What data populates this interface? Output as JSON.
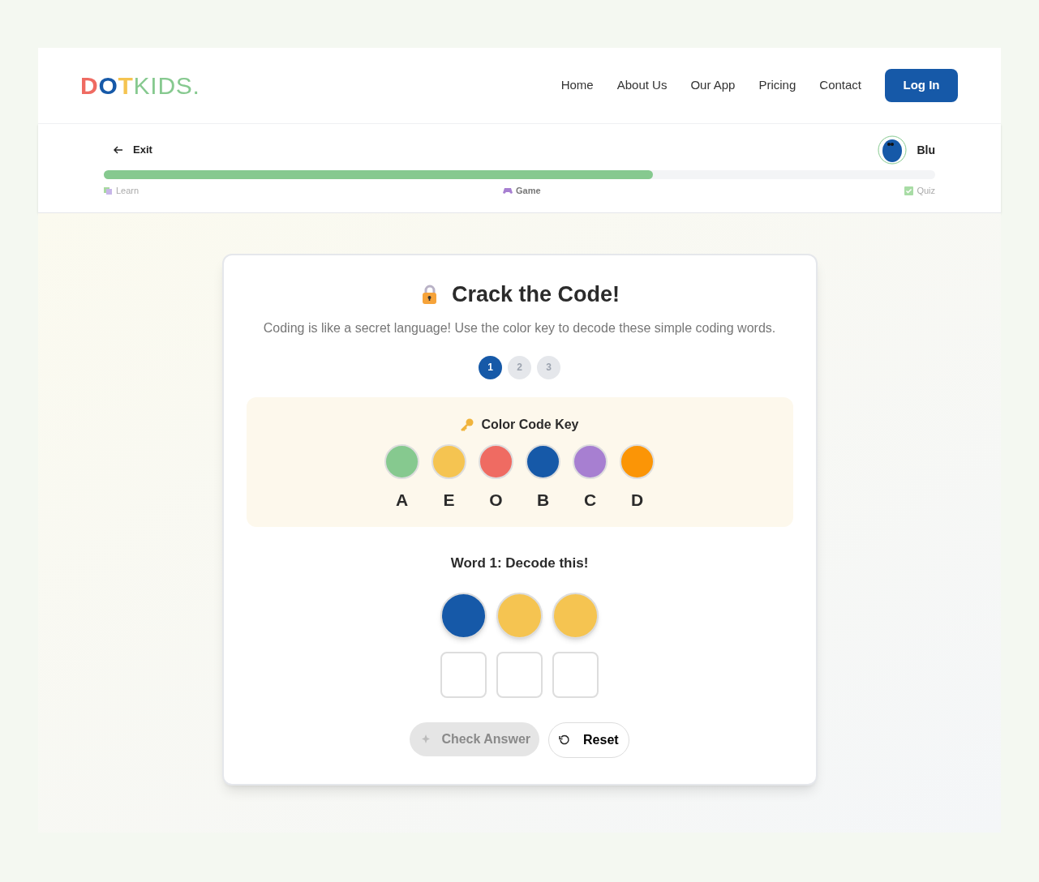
{
  "logo": [
    {
      "text": "D",
      "color": "#ef6b62"
    },
    {
      "text": "O",
      "color": "#1659a8"
    },
    {
      "text": "T",
      "color": "#f5c451"
    },
    {
      "text": "KIDS.",
      "color": "#86c98f"
    }
  ],
  "nav": [
    {
      "label": "Home"
    },
    {
      "label": "About Us"
    },
    {
      "label": "Our App"
    },
    {
      "label": "Pricing"
    },
    {
      "label": "Contact"
    }
  ],
  "login_button": "Log In",
  "exit": "Exit",
  "user": {
    "name": "Blu"
  },
  "progress": {
    "level": 0.66,
    "stages": [
      {
        "label": "Learn",
        "kind": "learn",
        "current": false
      },
      {
        "label": "Game",
        "kind": "game",
        "current": true
      },
      {
        "label": "Quiz",
        "kind": "quiz",
        "current": false
      }
    ]
  },
  "game": {
    "title": "Crack the Code!",
    "description": "Coding is like a secret language! Use the color key to decode these simple coding words.",
    "steps": [
      {
        "label": "1",
        "selected": true
      },
      {
        "label": "2",
        "selected": false
      },
      {
        "label": "3",
        "selected": false
      }
    ],
    "key_title": "Color Code Key",
    "key": [
      {
        "letter": "A",
        "color": "#86c98f"
      },
      {
        "letter": "E",
        "color": "#f5c451"
      },
      {
        "letter": "O",
        "color": "#ef6b62"
      },
      {
        "letter": "B",
        "color": "#1659a8"
      },
      {
        "letter": "C",
        "color": "#a77fd1"
      },
      {
        "letter": "D",
        "color": "#fb9506"
      }
    ],
    "word_title": "Word 1: Decode this!",
    "word": [
      {
        "color": "#1659a8"
      },
      {
        "color": "#f5c451"
      },
      {
        "color": "#f5c451"
      }
    ],
    "answer": [
      {
        "kind": "empty"
      },
      {
        "kind": "empty"
      },
      {
        "kind": "empty"
      }
    ],
    "check_button": {
      "label": "Check Answer",
      "disabled": true
    },
    "reset_button": "Reset"
  }
}
